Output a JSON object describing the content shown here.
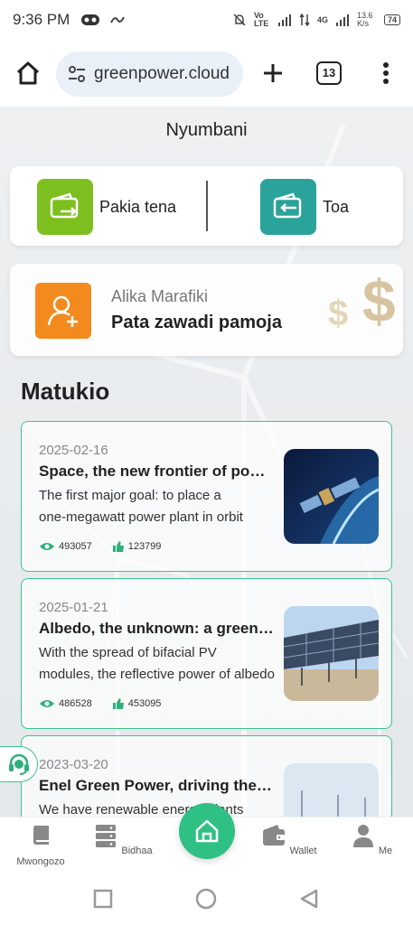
{
  "status_bar": {
    "time": "9:36 PM",
    "network": "Vo LTE",
    "net_type": "4G",
    "speed": "13.6 K/s",
    "battery": "74"
  },
  "browser": {
    "url": "greenpower.cloud",
    "tab_count": "13"
  },
  "page": {
    "title": "Nyumbani"
  },
  "actions": {
    "recharge_label": "Pakia tena",
    "withdraw_label": "Toa",
    "recharge_color": "#7dbf1e",
    "withdraw_color": "#2aa39a"
  },
  "invite": {
    "subtitle": "Alika Marafiki",
    "title": "Pata zawadi pamoja"
  },
  "news_section": {
    "title": "Matukio",
    "items": [
      {
        "date": "2025-02-16",
        "title": "Space, the new frontier of power",
        "desc_line1": "The first major goal: to place a",
        "desc_line2": "one-megawatt power plant in orbit",
        "views": "493057",
        "likes": "123799",
        "thumb": "satellite"
      },
      {
        "date": "2025-01-21",
        "title": "Albedo, the unknown: a green ally",
        "desc_line1": "With the spread of bifacial PV",
        "desc_line2": "modules, the reflective power of albedo",
        "views": "486528",
        "likes": "453095",
        "thumb": "solar-panels"
      },
      {
        "date": "2023-03-20",
        "title": "Enel Green Power, driving the transition",
        "desc_line1": "We have renewable energy plants",
        "thumb": "wind-turbines"
      }
    ]
  },
  "bottom_nav": {
    "items": [
      {
        "label": "Mwongozo",
        "icon": "book-icon"
      },
      {
        "label": "Bidhaa",
        "icon": "server-icon"
      },
      {
        "label": "",
        "icon": "home-icon"
      },
      {
        "label": "Wallet",
        "icon": "wallet-icon"
      },
      {
        "label": "Me",
        "icon": "user-icon"
      }
    ]
  },
  "colors": {
    "accent": "#2fc083",
    "card_border": "#3cc48c",
    "invite_icon": "#f28a1e"
  }
}
